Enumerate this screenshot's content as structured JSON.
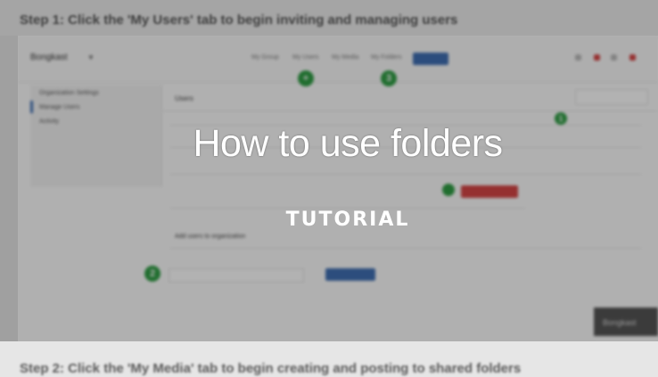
{
  "step1": {
    "text": "Step 1: Click the 'My Users' tab to begin inviting and managing users"
  },
  "step2": {
    "text": "Step 2: Click the 'My Media' tab to begin creating and posting to shared folders"
  },
  "overlay": {
    "title": "How to use folders",
    "subtitle": "TUTORIAL"
  },
  "app": {
    "brand": "Bongkast",
    "nav": [
      "My Group",
      "My Users",
      "My Media",
      "My Folders"
    ],
    "sidebar": [
      "Organization Settings",
      "Manage Users",
      "Activity"
    ],
    "panel_title": "Users",
    "section_title": "Add users to organization",
    "corner_label": "Bongkast",
    "markers": [
      "+",
      "1",
      "2",
      "3"
    ]
  },
  "colors": {
    "accent_blue": "#3f6fb3",
    "marker_green": "#2f9e44",
    "danger_red": "#d64545"
  }
}
